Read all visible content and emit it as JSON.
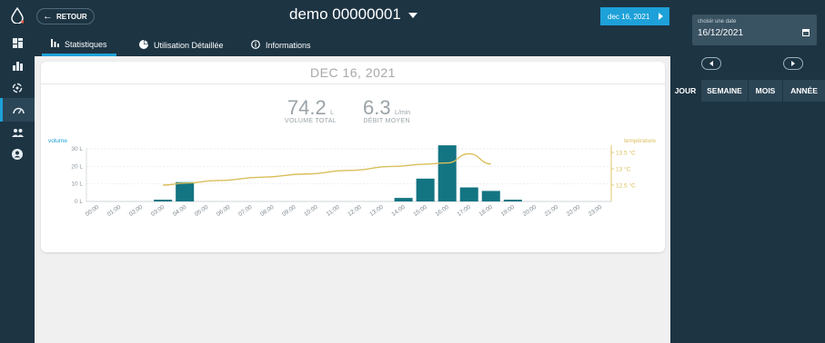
{
  "app": {
    "back_label": "RETOUR",
    "device_title": "demo 00000001",
    "date_pill": "dec 16, 2021"
  },
  "rail": [
    "water-drop-logo",
    "dashboard-icon",
    "bar-stats-icon",
    "usage-icon",
    "gauge-icon",
    "users-icon",
    "account-icon"
  ],
  "tabs": [
    {
      "label": "Statistiques",
      "icon": "bar-chart-icon"
    },
    {
      "label": "Utilisation Détaillée",
      "icon": "pie-chart-icon"
    },
    {
      "label": "Informations",
      "icon": "info-icon"
    }
  ],
  "card": {
    "date_heading": "DEC 16, 2021",
    "volume_value": "74.2",
    "volume_unit": "L",
    "volume_label": "VOLUME TOTAL",
    "flow_value": "6.3",
    "flow_unit": "L/min",
    "flow_label": "DÉBIT MOYEN"
  },
  "right_panel": {
    "date_label": "choisir une date",
    "date_value": "16/12/2021",
    "periods": [
      "JOUR",
      "SEMAINE",
      "MOIS",
      "ANNÉE"
    ],
    "active_period": "JOUR"
  },
  "colors": {
    "navy": "#1d3443",
    "accent": "#1da1d8",
    "bar": "#137482",
    "temperature": "#d9bf5a"
  },
  "chart_data": {
    "type": "bar",
    "left_axis_label": "volume",
    "right_axis_label": "température",
    "categories": [
      "00:00",
      "01:00",
      "02:00",
      "03:00",
      "04:00",
      "05:00",
      "06:00",
      "07:00",
      "08:00",
      "09:00",
      "10:00",
      "11:00",
      "12:00",
      "13:00",
      "14:00",
      "15:00",
      "16:00",
      "17:00",
      "18:00",
      "19:00",
      "20:00",
      "21:00",
      "22:00",
      "23:00"
    ],
    "ylim": [
      0,
      30
    ],
    "yticks": [
      "0 L",
      "10 L",
      "20 L",
      "30 L"
    ],
    "y2ticks": [
      "12.5 °C",
      "13 °C",
      "13.5 °C"
    ],
    "series": [
      {
        "name": "volume",
        "kind": "bar",
        "values": [
          0,
          0,
          0,
          1,
          11,
          0,
          0,
          0,
          0,
          0,
          0,
          0,
          0,
          0,
          2,
          13,
          32,
          8,
          6,
          1,
          0,
          0,
          0,
          0
        ]
      },
      {
        "name": "température",
        "kind": "line",
        "axis": "right",
        "x": [
          3.5,
          4.5,
          6,
          8,
          10,
          12,
          14,
          15.5,
          16.5,
          17.5,
          18.5
        ],
        "values": [
          12.5,
          12.56,
          12.64,
          12.74,
          12.84,
          12.95,
          13.07,
          13.14,
          13.18,
          13.46,
          13.15
        ]
      }
    ]
  }
}
